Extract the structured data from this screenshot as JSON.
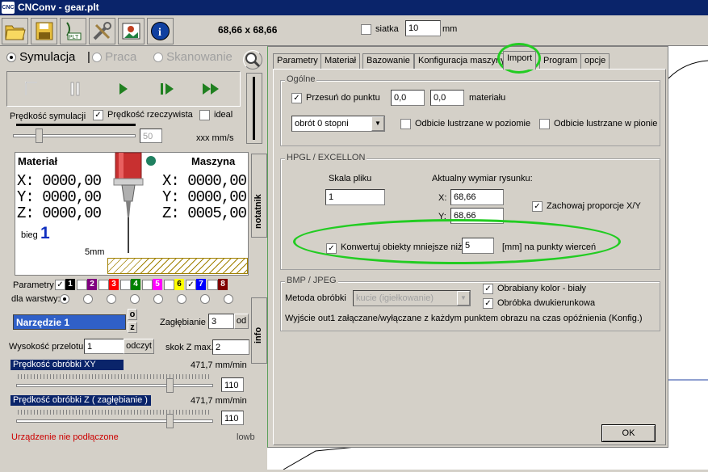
{
  "window": {
    "title": "CNConv - gear.plt",
    "app_icon": "cnconv-icon"
  },
  "toolbar": {
    "buttons": [
      "open-folder-icon",
      "save-disk-icon",
      "import-plt-icon",
      "tools-icon",
      "image-icon",
      "info-icon"
    ],
    "dimensions": "68,66 x 68,66",
    "grid_label": "siatka",
    "grid_value": "10",
    "grid_unit": "mm"
  },
  "mode": {
    "sim_label": "Symulacja",
    "work_label": "Praca",
    "scan_label": "Skanowanie",
    "separator": "|"
  },
  "sim": {
    "speed_label": "Prędkość symulacji",
    "real_speed_label": "Prędkość rzeczywista",
    "ideal_label": "ideal",
    "speed_value": "50",
    "speed_unit": "xxx  mm/s"
  },
  "dro": {
    "material_label": "Materiał",
    "machine_label": "Maszyna",
    "mx": "X: 0000,00",
    "my": "Y: 0000,00",
    "mz": "Z: 0000,00",
    "nx": "X: 0000,00",
    "ny": "Y: 0000,00",
    "nz": "Z: 0005,00",
    "gear_label": "bieg",
    "gear_value": "1",
    "depth_label": "5mm"
  },
  "side_tabs": {
    "notes": "notatnik",
    "info": "info"
  },
  "layers": {
    "params_label": "Parametry",
    "for_layers_label": "dla warstwy:",
    "items": [
      {
        "num": "1",
        "color": "#000000",
        "text": "#ffffff",
        "checked": true
      },
      {
        "num": "2",
        "color": "#800080",
        "text": "#ffffff",
        "checked": false
      },
      {
        "num": "3",
        "color": "#ff0000",
        "text": "#ffffff",
        "checked": false
      },
      {
        "num": "4",
        "color": "#008000",
        "text": "#ffffff",
        "checked": false
      },
      {
        "num": "5",
        "color": "#ff00ff",
        "text": "#ffffff",
        "checked": false
      },
      {
        "num": "6",
        "color": "#ffff00",
        "text": "#000000",
        "checked": false
      },
      {
        "num": "7",
        "color": "#0000ff",
        "text": "#ffffff",
        "checked": true
      },
      {
        "num": "8",
        "color": "#800000",
        "text": "#ffffff",
        "checked": false
      }
    ]
  },
  "tool": {
    "name": "Narzędzie 1",
    "btn_o": "o",
    "btn_z": "z",
    "plunge_label": "Zagłębianie",
    "plunge_value": "3",
    "plunge_btn": "od",
    "travel_label": "Wysokość przelotu",
    "travel_value": "1",
    "read_btn": "odczyt",
    "zstep_label": "skok Z max.",
    "zstep_value": "2",
    "speed_xy_label": "Prędkość obróbki XY",
    "speed_xy_value": "471,7 mm/min",
    "speed_xy_field": "110",
    "speed_z_label": "Prędkość obróbki Z  ( zagłębianie )",
    "speed_z_value": "471,7 mm/min",
    "speed_z_field": "110"
  },
  "status": {
    "device": "Urządzenie nie podłączone",
    "speed": "lowb"
  },
  "dialog": {
    "tabs": [
      "Parametry",
      "Materiał",
      "Bazowanie",
      "Konfiguracja maszyny",
      "Import",
      "Program",
      "opcje"
    ],
    "active_tab": "Import",
    "general": {
      "title": "Ogólne",
      "shift_label": "Przesuń do punktu",
      "shift_x": "0,0",
      "shift_y": "0,0",
      "material_label": "materiału",
      "rotation_value": "obrót 0 stopni",
      "mirror_h_label": "Odbicie lustrzane w poziomie",
      "mirror_v_label": "Odbicie lustrzane w pionie"
    },
    "hpgl": {
      "title": "HPGL / EXCELLON",
      "scale_label": "Skala pliku",
      "scale_value": "1",
      "current_label": "Aktualny wymiar rysunku:",
      "x_label": "X:",
      "x_value": "68,66",
      "y_label": "Y:",
      "y_value": "68,66",
      "keep_ratio_label": "Zachowaj proporcje X/Y",
      "convert_label": "Konwertuj obiekty mniejsze niż",
      "convert_value": "5",
      "convert_suffix": "[mm] na punkty wierceń"
    },
    "bmp": {
      "title": "BMP / JPEG",
      "method_label": "Metoda obróbki",
      "method_value": "kucie (igiełkowanie)",
      "color_label": "Obrabiany kolor - biały",
      "two_dir_label": "Obróbka dwukierunkowa",
      "output_text": "Wyjście out1 załączane/wyłączane z każdym punktem obrazu na czas opóźnienia (Konfig.)"
    },
    "ok_label": "OK"
  },
  "colors": {
    "highlight": "#22cc22",
    "title_bg": "#0a246a",
    "status_red": "#cc0000"
  }
}
